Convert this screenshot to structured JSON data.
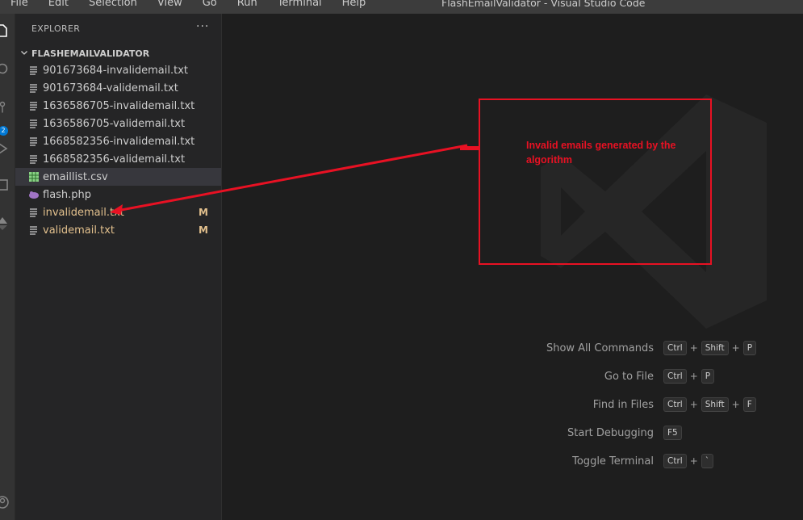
{
  "menu": {
    "items": [
      "File",
      "Edit",
      "Selection",
      "View",
      "Go",
      "Run",
      "Terminal",
      "Help"
    ]
  },
  "window_title": "FlashEmailValidator - Visual Studio Code",
  "activity_bar": {
    "scm_badge": "2",
    "icons": [
      "explorer-icon",
      "search-icon",
      "source-control-icon",
      "run-debug-icon",
      "extensions-icon",
      "remote-icon",
      "account-icon"
    ]
  },
  "explorer": {
    "header": "EXPLORER",
    "more_label": "···",
    "folder": "FLASHEMAILVALIDATOR",
    "files": [
      {
        "name": "901673684-invalidemail.txt",
        "icon": "text-file-icon"
      },
      {
        "name": "901673684-validemail.txt",
        "icon": "text-file-icon"
      },
      {
        "name": "1636586705-invalidemail.txt",
        "icon": "text-file-icon"
      },
      {
        "name": "1636586705-validemail.txt",
        "icon": "text-file-icon"
      },
      {
        "name": "1668582356-invalidemail.txt",
        "icon": "text-file-icon"
      },
      {
        "name": "1668582356-validemail.txt",
        "icon": "text-file-icon"
      },
      {
        "name": "emaillist.csv",
        "icon": "csv-file-icon",
        "selected": true
      },
      {
        "name": "flash.php",
        "icon": "php-file-icon"
      },
      {
        "name": "invalidemail.txt",
        "icon": "text-file-icon",
        "status": "M"
      },
      {
        "name": "validemail.txt",
        "icon": "text-file-icon",
        "status": "M"
      }
    ]
  },
  "welcome": {
    "shortcuts": [
      {
        "label": "Show All Commands",
        "keys": [
          "Ctrl",
          "Shift",
          "P"
        ]
      },
      {
        "label": "Go to File",
        "keys": [
          "Ctrl",
          "P"
        ]
      },
      {
        "label": "Find in Files",
        "keys": [
          "Ctrl",
          "Shift",
          "F"
        ]
      },
      {
        "label": "Start Debugging",
        "keys": [
          "F5"
        ]
      },
      {
        "label": "Toggle Terminal",
        "keys": [
          "Ctrl",
          "`"
        ]
      }
    ]
  },
  "annotation": {
    "text": "Invalid emails generated by the algorithm",
    "color": "#e81123"
  },
  "colors": {
    "modified": "#e2c08d",
    "badge": "#0078d4"
  }
}
